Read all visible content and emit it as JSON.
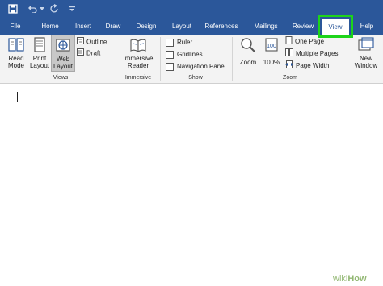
{
  "tabs": [
    {
      "label": "File",
      "active": false
    },
    {
      "label": "Home",
      "active": false
    },
    {
      "label": "Insert",
      "active": false
    },
    {
      "label": "Draw",
      "active": false
    },
    {
      "label": "Design",
      "active": false
    },
    {
      "label": "Layout",
      "active": false
    },
    {
      "label": "References",
      "active": false
    },
    {
      "label": "Mailings",
      "active": false
    },
    {
      "label": "Review",
      "active": false
    },
    {
      "label": "View",
      "active": true
    },
    {
      "label": "Help",
      "active": false
    }
  ],
  "views": {
    "read_mode": [
      "Read",
      "Mode"
    ],
    "print_layout": [
      "Print",
      "Layout"
    ],
    "web_layout": [
      "Web",
      "Layout"
    ],
    "outline": "Outline",
    "draft": "Draft",
    "group": "Views"
  },
  "immersive": {
    "reader": [
      "Immersive",
      "Reader"
    ],
    "group": "Immersive"
  },
  "show": {
    "ruler": "Ruler",
    "gridlines": "Gridlines",
    "navigation_pane": "Navigation Pane",
    "group": "Show"
  },
  "zoom": {
    "zoom": "Zoom",
    "hundred": "100%",
    "one_page": "One Page",
    "multiple_pages": "Multiple Pages",
    "page_width": "Page Width",
    "group": "Zoom"
  },
  "window": {
    "new_window": [
      "New",
      "Window"
    ]
  },
  "watermark": {
    "wiki": "wiki",
    "how": "How"
  },
  "colors": {
    "brand": "#2b579a",
    "highlight": "#1dd41a",
    "ribbon": "#f3f3f3",
    "wiki_green": "#93b874"
  }
}
